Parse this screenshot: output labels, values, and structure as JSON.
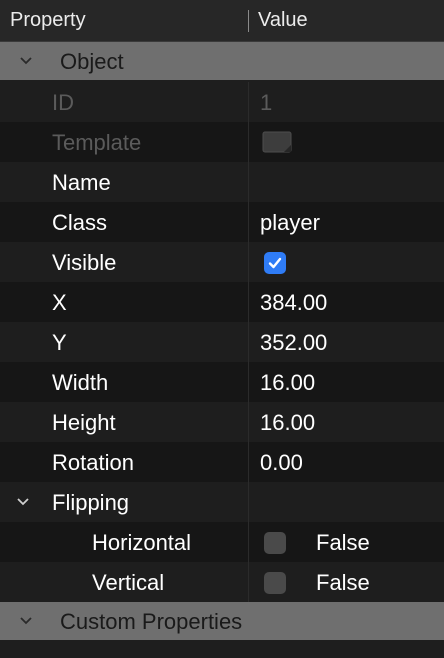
{
  "header": {
    "property": "Property",
    "value": "Value"
  },
  "groups": {
    "object": "Object",
    "custom": "Custom Properties"
  },
  "props": {
    "id": {
      "label": "ID",
      "value": "1"
    },
    "template": {
      "label": "Template"
    },
    "name": {
      "label": "Name",
      "value": ""
    },
    "class": {
      "label": "Class",
      "value": "player"
    },
    "visible": {
      "label": "Visible",
      "checked": true
    },
    "x": {
      "label": "X",
      "value": "384.00"
    },
    "y": {
      "label": "Y",
      "value": "352.00"
    },
    "width": {
      "label": "Width",
      "value": "16.00"
    },
    "height": {
      "label": "Height",
      "value": "16.00"
    },
    "rotation": {
      "label": "Rotation",
      "value": "0.00"
    },
    "flipping": {
      "label": "Flipping",
      "horizontal": {
        "label": "Horizontal",
        "value": "False"
      },
      "vertical": {
        "label": "Vertical",
        "value": "False"
      }
    }
  },
  "icons": {
    "group_toggle": "chevron-down-icon",
    "template": "template-icon",
    "check": "checkmark-icon"
  },
  "colors": {
    "accent": "#2f7cf6",
    "group_bg": "#6f6f6f",
    "disabled_text": "#5b5b5b"
  }
}
